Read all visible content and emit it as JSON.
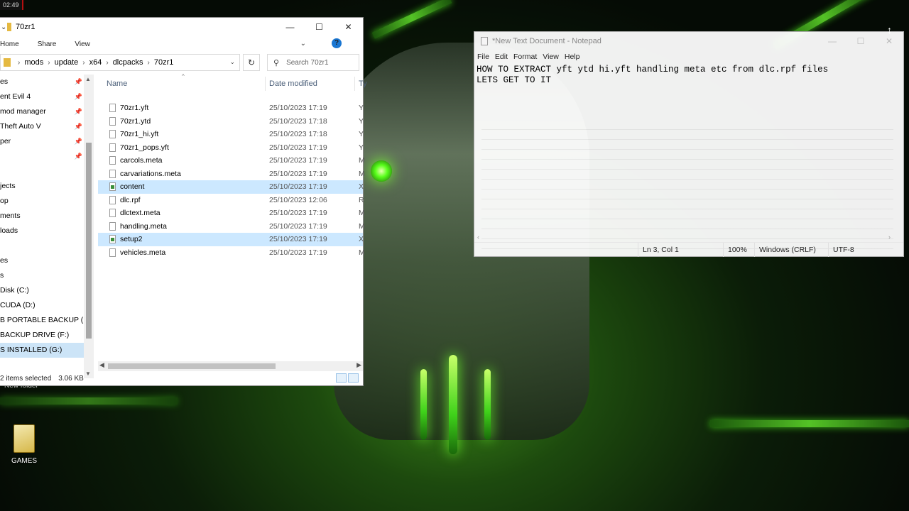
{
  "clock": "02:49",
  "explorer": {
    "title": "70zr1",
    "ribbon": [
      "Home",
      "Share",
      "View"
    ],
    "help": "?",
    "address": {
      "crumbs": [
        "mods",
        "update",
        "x64",
        "dlcpacks",
        "70zr1"
      ]
    },
    "search_placeholder": "Search 70zr1",
    "nav_items": [
      {
        "label": "es",
        "pinned": true
      },
      {
        "label": "ent Evil 4",
        "pinned": true
      },
      {
        "label": "mod manager",
        "pinned": true
      },
      {
        "label": " Theft Auto V",
        "pinned": true
      },
      {
        "label": "per",
        "pinned": true
      },
      {
        "label": "",
        "pinned": true
      },
      {
        "label": "",
        "pinned": false
      },
      {
        "label": "jects",
        "pinned": false
      },
      {
        "label": "op",
        "pinned": false
      },
      {
        "label": "ments",
        "pinned": false
      },
      {
        "label": "loads",
        "pinned": false
      },
      {
        "label": "",
        "pinned": false
      },
      {
        "label": "es",
        "pinned": false
      },
      {
        "label": "s",
        "pinned": false
      },
      {
        "label": " Disk (C:)",
        "pinned": false
      },
      {
        "label": "CUDA (D:)",
        "pinned": false
      },
      {
        "label": "B  PORTABLE BACKUP (E:",
        "pinned": false
      },
      {
        "label": " BACKUP DRIVE (F:)",
        "pinned": false
      },
      {
        "label": "S INSTALLED (G:)",
        "pinned": false
      }
    ],
    "columns": {
      "name": "Name",
      "date": "Date modified",
      "type": "Ty"
    },
    "files": [
      {
        "name": "70zr1.yft",
        "date": "25/10/2023 17:19",
        "type": "Y",
        "selected": false,
        "xml": false
      },
      {
        "name": "70zr1.ytd",
        "date": "25/10/2023 17:18",
        "type": "Y",
        "selected": false,
        "xml": false
      },
      {
        "name": "70zr1_hi.yft",
        "date": "25/10/2023 17:18",
        "type": "Y",
        "selected": false,
        "xml": false
      },
      {
        "name": "70zr1_pops.yft",
        "date": "25/10/2023 17:19",
        "type": "Y",
        "selected": false,
        "xml": false
      },
      {
        "name": "carcols.meta",
        "date": "25/10/2023 17:19",
        "type": "M",
        "selected": false,
        "xml": false
      },
      {
        "name": "carvariations.meta",
        "date": "25/10/2023 17:19",
        "type": "M",
        "selected": false,
        "xml": false
      },
      {
        "name": "content",
        "date": "25/10/2023 17:19",
        "type": "X",
        "selected": true,
        "xml": true
      },
      {
        "name": "dlc.rpf",
        "date": "25/10/2023 12:06",
        "type": "R",
        "selected": false,
        "xml": false
      },
      {
        "name": "dlctext.meta",
        "date": "25/10/2023 17:19",
        "type": "M",
        "selected": false,
        "xml": false
      },
      {
        "name": "handling.meta",
        "date": "25/10/2023 17:19",
        "type": "M",
        "selected": false,
        "xml": false
      },
      {
        "name": "setup2",
        "date": "25/10/2023 17:19",
        "type": "X",
        "selected": true,
        "xml": true
      },
      {
        "name": "vehicles.meta",
        "date": "25/10/2023 17:19",
        "type": "M",
        "selected": false,
        "xml": false
      }
    ],
    "status_selected": "2 items selected",
    "status_size": "3.06 KB"
  },
  "notepad": {
    "title": "*New Text Document - Notepad",
    "menu": [
      "File",
      "Edit",
      "Format",
      "View",
      "Help"
    ],
    "lines": [
      "HOW TO EXTRACT yft ytd hi.yft handling meta etc from dlc.rpf files",
      "LETS GET TO IT"
    ],
    "status": {
      "position": "Ln 3, Col 1",
      "zoom": "100%",
      "line_ending": "Windows (CRLF)",
      "encoding": "UTF-8"
    }
  },
  "desktop": {
    "new_folder_label": "New folder",
    "games_label": "GAMES"
  },
  "colors": {
    "selection": "#cce8ff",
    "accent": "#1976d2",
    "wallpaper_glow": "#58ff1a"
  }
}
